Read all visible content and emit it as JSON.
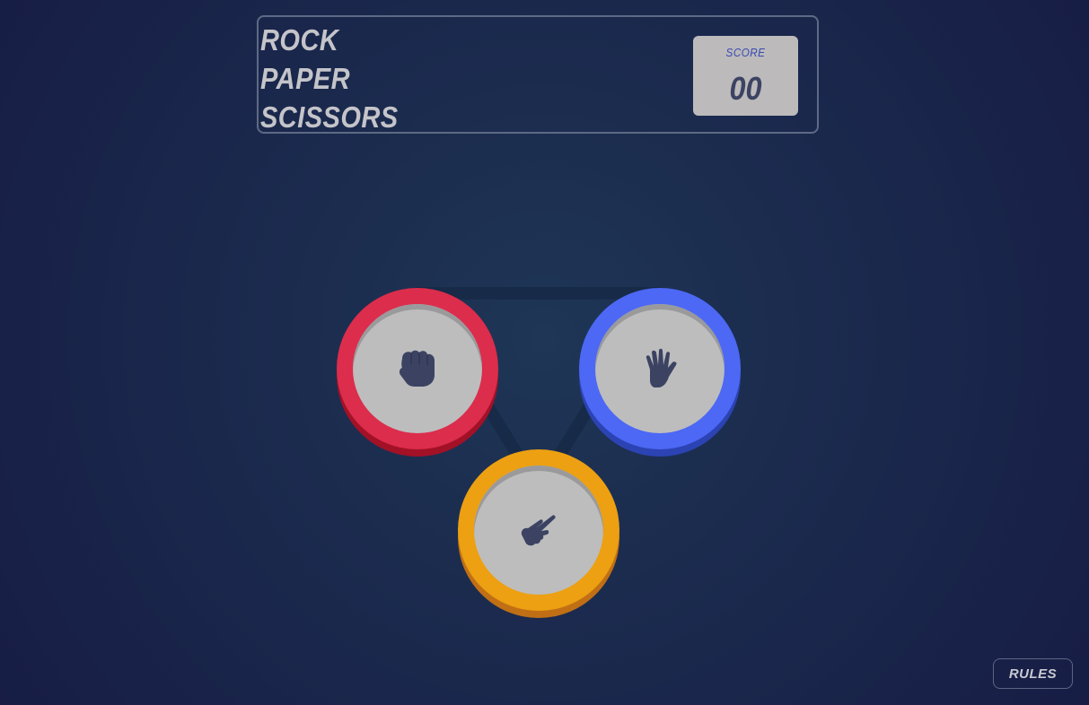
{
  "header": {
    "title_lines": [
      "ROCK",
      "PAPER",
      "SCISSORS"
    ]
  },
  "score": {
    "label": "SCORE",
    "value": "00"
  },
  "choices": [
    {
      "name": "rock",
      "ring_color": "#dc2d4c",
      "icon": "fist-icon"
    },
    {
      "name": "paper",
      "ring_color": "#4c68f4",
      "icon": "open-hand-icon"
    },
    {
      "name": "scissors",
      "ring_color": "#eca012",
      "icon": "scissors-hand-icon"
    }
  ],
  "colors": {
    "background": "#1b2b4e",
    "icon": "#3c4362",
    "chip_face": "#bdbdbe"
  },
  "rules_button": {
    "label": "RULES"
  }
}
